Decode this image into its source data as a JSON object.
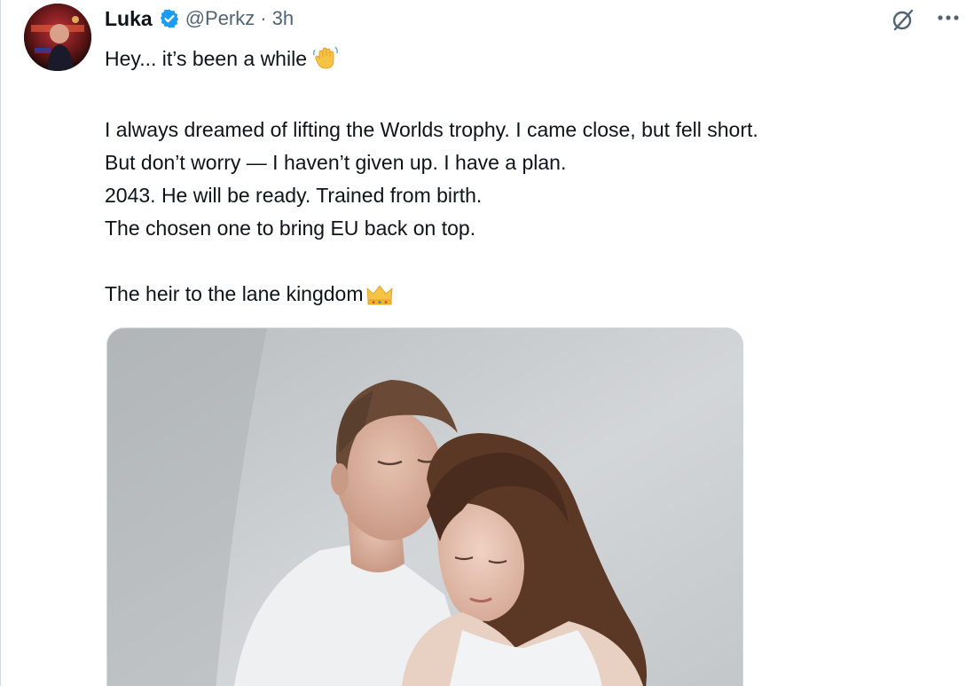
{
  "author": {
    "name": "Luka",
    "handle": "@Perkz",
    "separator": "·",
    "time": "3h",
    "verified": true,
    "verified_color": "#1d9bf0"
  },
  "tweet": {
    "lines": [
      "Hey... it’s been a while",
      "",
      "I always dreamed of lifting the Worlds trophy. I came close, but fell short.",
      "But don’t worry — I haven’t given up. I have a plan.",
      "2043. He will be ready. Trained from birth.",
      "The chosen one to bring EU back on top.",
      "",
      "The heir to the lane kingdom"
    ],
    "emojis": {
      "line_0": "waving-hand",
      "line_7": "crown"
    }
  },
  "media": {
    "type": "photo",
    "description_icon": "photo-of-couple"
  },
  "icons": {
    "grok": "grok-icon",
    "more": "more-options-icon"
  }
}
